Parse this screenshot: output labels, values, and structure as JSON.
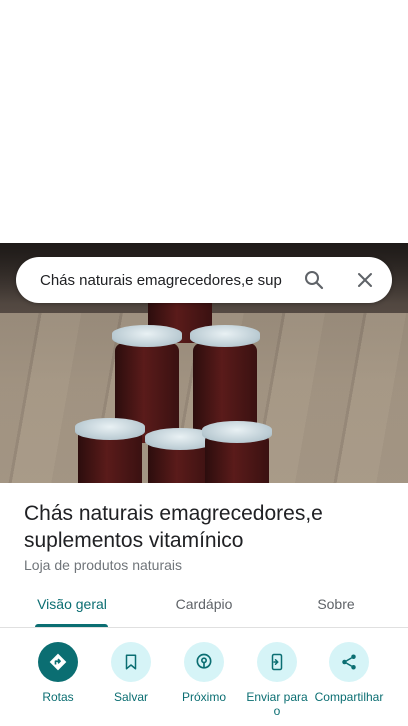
{
  "search": {
    "value": "Chás naturais emagrecedores,e sup"
  },
  "place": {
    "title": "Chás naturais emagrecedores,e suplementos vitamínico",
    "category": "Loja de produtos naturais"
  },
  "tabs": [
    {
      "label": "Visão geral",
      "active": true
    },
    {
      "label": "Cardápio"
    },
    {
      "label": "Sobre"
    }
  ],
  "actions": [
    {
      "label": "Rotas",
      "icon": "directions-icon"
    },
    {
      "label": "Salvar",
      "icon": "bookmark-icon"
    },
    {
      "label": "Próximo",
      "icon": "nearby-icon"
    },
    {
      "label": "Enviar para o",
      "icon": "send-to-phone-icon"
    },
    {
      "label": "Compartilhar",
      "icon": "share-icon"
    }
  ],
  "colors": {
    "accent": "#0b6e72",
    "action_bg": "#d6f4f7",
    "text": "#202124",
    "muted": "#70757a"
  }
}
